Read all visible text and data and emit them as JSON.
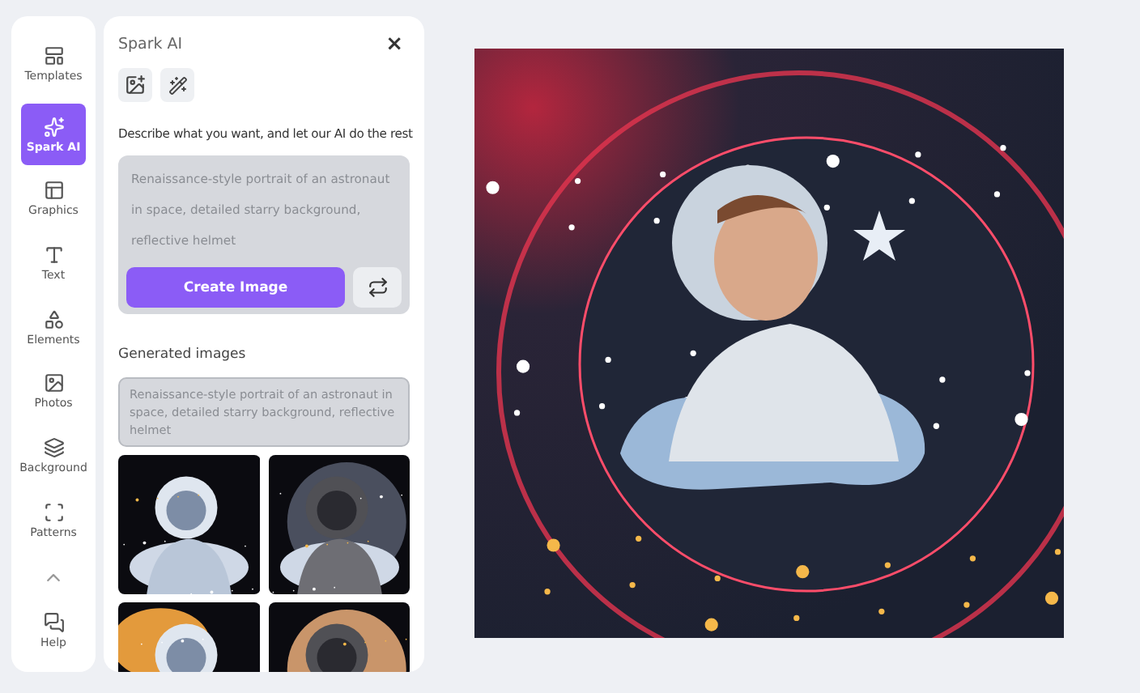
{
  "sidebar": {
    "items": [
      {
        "label": "Templates",
        "selected": false
      },
      {
        "label": "Spark AI",
        "selected": true
      },
      {
        "label": "Graphics",
        "selected": false
      },
      {
        "label": "Text",
        "selected": false
      },
      {
        "label": "Elements",
        "selected": false
      },
      {
        "label": "Photos",
        "selected": false
      },
      {
        "label": "Background",
        "selected": false
      },
      {
        "label": "Patterns",
        "selected": false
      }
    ],
    "help": {
      "label": "Help"
    }
  },
  "panel": {
    "title": "Spark AI",
    "close": "×",
    "description": "Describe what you want, and let our AI do the rest",
    "prompt_field": {
      "value": "Renaissance-style portrait of an astronaut in space, detailed starry background, reflective helmet"
    },
    "create_button": "Create Image",
    "generated_heading": "Generated images",
    "generated_prompt": "Renaissance-style portrait of an astronaut in space, detailed starry background, reflective helmet"
  }
}
